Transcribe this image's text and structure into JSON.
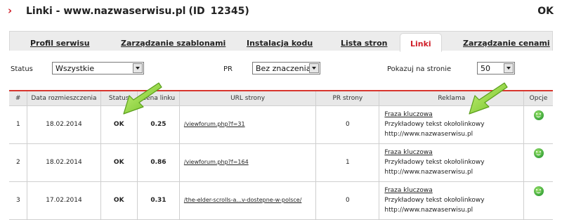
{
  "header": {
    "chevron": "›",
    "title": "Linki - www.nazwaserwisu.pl",
    "id_label": "(ID",
    "id_value": "12345)",
    "ok": "OK"
  },
  "tabs": [
    {
      "label": "Profil serwisu",
      "active": false
    },
    {
      "label": "Zarządzanie szablonami",
      "active": false
    },
    {
      "label": "Instalacja kodu",
      "active": false
    },
    {
      "label": "Lista stron",
      "active": false
    },
    {
      "label": "Linki",
      "active": true
    },
    {
      "label": "Zarządzanie cenami",
      "active": false
    }
  ],
  "filters": {
    "status": {
      "label": "Status",
      "value": "Wszystkie"
    },
    "pr": {
      "label": "PR",
      "value": "Bez znaczenia"
    },
    "per_page": {
      "label": "Pokazuj na stronie",
      "value": "50"
    }
  },
  "table": {
    "headers": [
      "#",
      "Data rozmieszczenia",
      "Status",
      "Cena linku",
      "URL strony",
      "PR strony",
      "Reklama",
      "Opcje"
    ],
    "rows": [
      {
        "num": "1",
        "date": "18.02.2014",
        "status": "OK",
        "price": "0.25",
        "url": "/viewforum.php?f=31",
        "pr": "0",
        "ad_title": "Fraza kluczowa",
        "ad_text": "Przykładowy tekst okołolinkowy",
        "ad_url": "http://www.nazwaserwisu.pl"
      },
      {
        "num": "2",
        "date": "18.02.2014",
        "status": "OK",
        "price": "0.86",
        "url": "/viewforum.php?f=164",
        "pr": "1",
        "ad_title": "Fraza kluczowa",
        "ad_text": "Przykładowy tekst okołolinkowy",
        "ad_url": "http://www.nazwaserwisu.pl"
      },
      {
        "num": "3",
        "date": "17.02.2014",
        "status": "OK",
        "price": "0.31",
        "url": "/the-elder-scrolls-a...v-dostepne-w-polsce/",
        "pr": "0",
        "ad_title": "Fraza kluczowa",
        "ad_text": "Przykładowy tekst okołolinkowy",
        "ad_url": "http://www.nazwaserwisu.pl"
      }
    ]
  },
  "icons": {
    "options": "smiley-icon",
    "pointer": "green-arrow-icon"
  },
  "colors": {
    "accent": "#d0202a",
    "status_ok": "#1a8a1a",
    "arrow": "#8fd43a"
  }
}
